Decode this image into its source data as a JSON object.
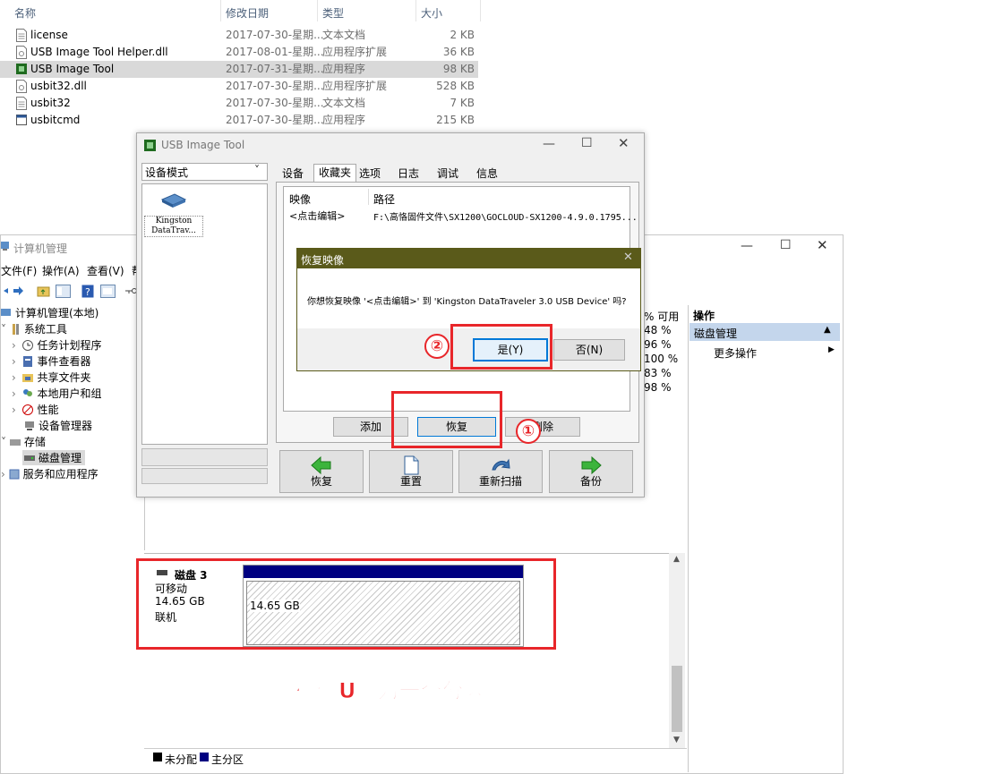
{
  "explorer": {
    "columns": {
      "name": "名称",
      "date": "修改日期",
      "type": "类型",
      "size": "大小"
    },
    "files": [
      {
        "name": "license",
        "date": "2017-07-30-星期...",
        "type": "文本文档",
        "size": "2 KB",
        "icon": "text-file-icon"
      },
      {
        "name": "USB Image Tool Helper.dll",
        "date": "2017-08-01-星期...",
        "type": "应用程序扩展",
        "size": "36 KB",
        "icon": "dll-file-icon"
      },
      {
        "name": "USB Image Tool",
        "date": "2017-07-31-星期...",
        "type": "应用程序",
        "size": "98 KB",
        "icon": "app-icon"
      },
      {
        "name": "usbit32.dll",
        "date": "2017-07-30-星期...",
        "type": "应用程序扩展",
        "size": "528 KB",
        "icon": "dll-file-icon"
      },
      {
        "name": "usbit32",
        "date": "2017-07-30-星期...",
        "type": "文本文档",
        "size": "7 KB",
        "icon": "text-file-icon"
      },
      {
        "name": "usbitcmd",
        "date": "2017-07-30-星期...",
        "type": "应用程序",
        "size": "215 KB",
        "icon": "cmd-app-icon"
      }
    ]
  },
  "cm": {
    "title": "计算机管理",
    "menu": {
      "file": "文件(F)",
      "action": "操作(A)",
      "view": "查看(V)",
      "help": "帮"
    },
    "tree": {
      "root": "计算机管理(本地)",
      "system_tools": "系统工具",
      "task_scheduler": "任务计划程序",
      "event_viewer": "事件查看器",
      "shared_folders": "共享文件夹",
      "local_users": "本地用户和组",
      "performance": "性能",
      "device_manager": "设备管理器",
      "storage": "存储",
      "disk_management": "磁盘管理",
      "services": "服务和应用程序"
    },
    "free_header": "% 可用",
    "free_values": [
      "48 %",
      "96 %",
      "100 %",
      "83 %",
      "98 %"
    ],
    "actions": {
      "header": "操作",
      "section": "磁盘管理",
      "more": "更多操作"
    },
    "disk": {
      "name": "磁盘 3",
      "type": "可移动",
      "size": "14.65 GB",
      "status": "联机",
      "partition_size": "14.65 GB"
    },
    "legend": {
      "unallocated": "未分配",
      "primary": "主分区"
    },
    "colors": {
      "primary": "#000080",
      "unallocated": "#000000"
    }
  },
  "uit": {
    "title": "USB Image Tool",
    "mode_select": "设备模式",
    "device_label": "Kingston DataTrav...",
    "tabs": [
      "设备",
      "收藏夹",
      "选项",
      "日志",
      "调试",
      "信息"
    ],
    "table": {
      "col_image": "映像",
      "col_path": "路径",
      "row_image": "<点击编辑>",
      "row_path": "F:\\高恪固件文件\\SX1200\\GOCLOUD-SX1200-4.9.0.1795..."
    },
    "buttons": {
      "add": "添加",
      "restore": "恢复",
      "remove": "删除"
    },
    "big_buttons": {
      "restore": "恢复",
      "reset": "重置",
      "rescan": "重新扫描",
      "backup": "备份"
    }
  },
  "dialog": {
    "title": "恢复映像",
    "message": "你想恢复映像 '<点击编辑>' 到 'Kingston DataTraveler 3.0 USB Device' 吗?",
    "yes": "是(Y)",
    "no": "否(N)"
  },
  "annotations": {
    "step1": "①",
    "step2": "②",
    "note": "确保U盘为一个分区",
    "color": "#e8262a"
  }
}
